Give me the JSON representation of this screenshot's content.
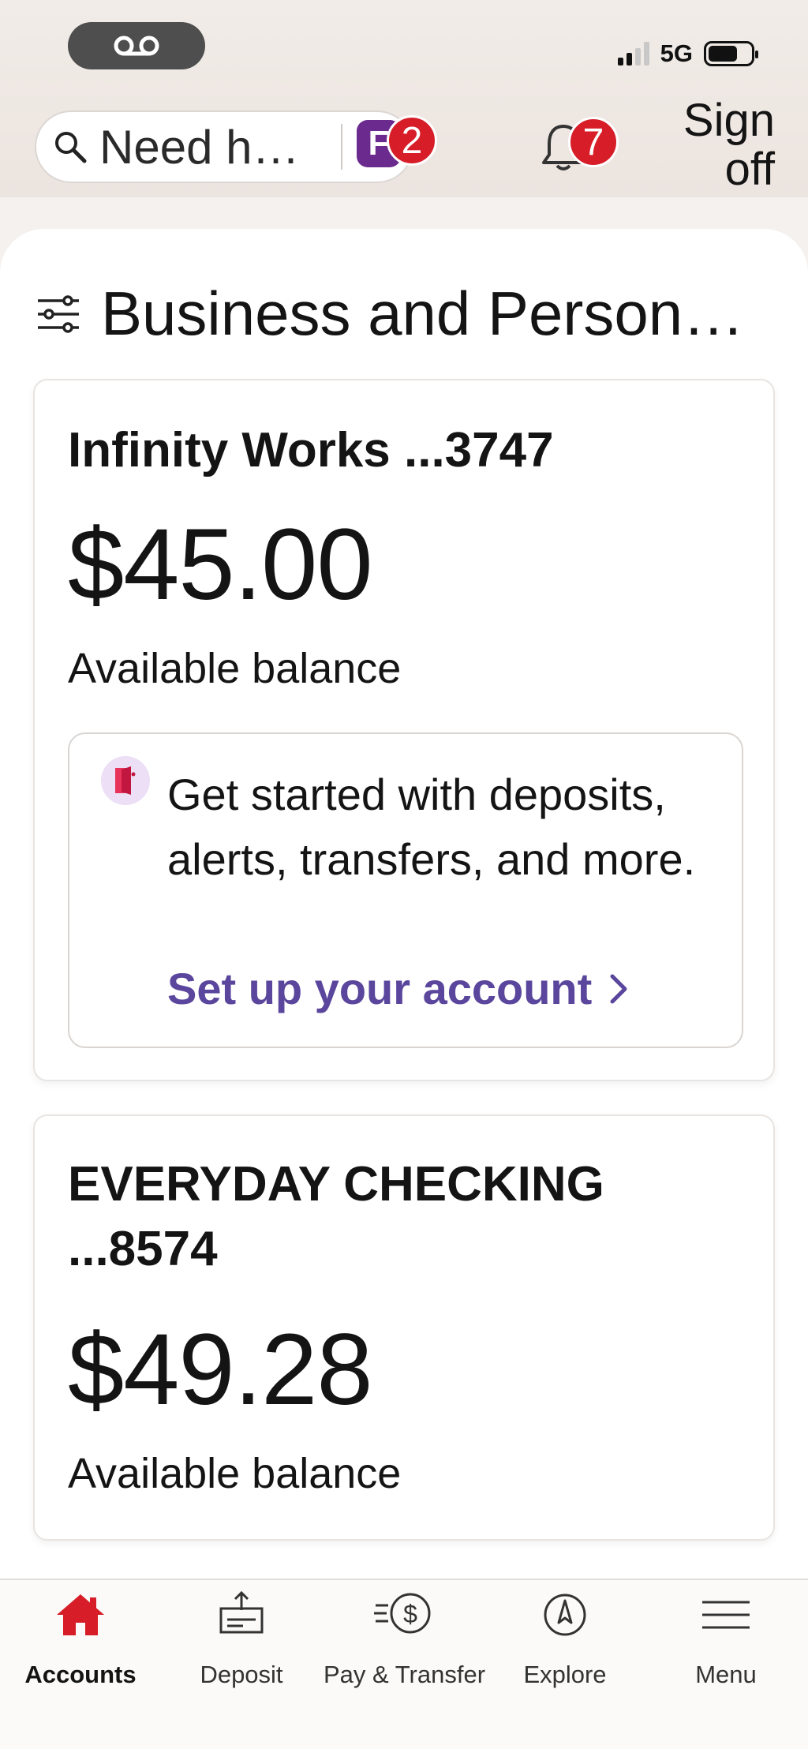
{
  "status_bar": {
    "network": "5G"
  },
  "top_bar": {
    "search_placeholder": "Need h…",
    "assistant_badge_letter": "F",
    "assistant_badge_count": "2",
    "notifications_count": "7",
    "sign_off_label": "Sign off"
  },
  "main": {
    "section_title": "Business and Person…",
    "accounts": [
      {
        "name": "Infinity Works ...3747",
        "amount": "$45.00",
        "caption": "Available balance",
        "setup": {
          "message": "Get started with deposits, alerts, transfers, and more.",
          "link_label": "Set up your account"
        }
      },
      {
        "name": "EVERYDAY CHECKING ...8574",
        "amount": "$49.28",
        "caption": "Available balance"
      }
    ]
  },
  "tabbar": {
    "tabs": [
      {
        "label": "Accounts",
        "icon": "home-icon",
        "active": true
      },
      {
        "label": "Deposit",
        "icon": "deposit-icon",
        "active": false
      },
      {
        "label": "Pay & Transfer",
        "icon": "pay-transfer-icon",
        "active": false
      },
      {
        "label": "Explore",
        "icon": "compass-icon",
        "active": false
      },
      {
        "label": "Menu",
        "icon": "hamburger-icon",
        "active": false
      }
    ]
  },
  "colors": {
    "brand_red": "#d71e28",
    "link_purple": "#5a469c",
    "assistant_purple": "#6b2a8e"
  }
}
